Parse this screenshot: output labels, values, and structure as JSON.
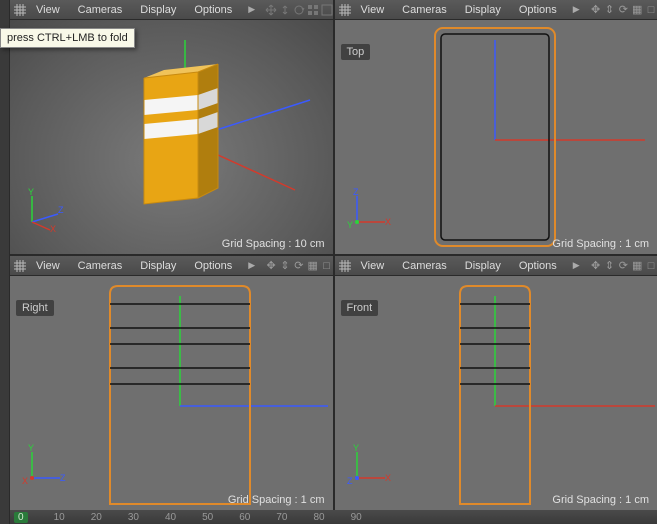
{
  "tooltip": "press CTRL+LMB to fold",
  "menus": {
    "view": "View",
    "cameras": "Cameras",
    "display": "Display",
    "options": "Options"
  },
  "viewports": {
    "perspective": {
      "label": "",
      "grid_spacing": "Grid Spacing : 10 cm"
    },
    "top": {
      "label": "Top",
      "grid_spacing": "Grid Spacing : 1 cm"
    },
    "right": {
      "label": "Right",
      "grid_spacing": "Grid Spacing : 1 cm"
    },
    "front": {
      "label": "Front",
      "grid_spacing": "Grid Spacing : 1 cm"
    }
  },
  "axes": {
    "x": "X",
    "y": "Y",
    "z": "Z"
  },
  "timeline": {
    "start": "0",
    "ticks": [
      "10",
      "20",
      "30",
      "40",
      "50",
      "60",
      "70",
      "80",
      "90"
    ]
  },
  "model": {
    "color_body": "#e8a514",
    "color_stripe": "#f5f5f5",
    "color_edge_sel": "#e08a2a"
  }
}
